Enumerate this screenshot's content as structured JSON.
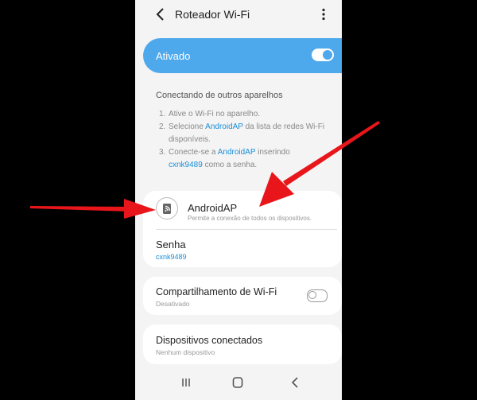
{
  "header": {
    "title": "Roteador Wi-Fi"
  },
  "master": {
    "label": "Ativado",
    "on": true
  },
  "help": {
    "title": "Conectando de outros aparelhos",
    "steps": [
      {
        "num": "1.",
        "text": "Ative o Wi-Fi no aparelho."
      },
      {
        "num": "2.",
        "pre": "Selecione ",
        "link": "AndroidAP",
        "post": " da lista de redes Wi-Fi disponíveis."
      },
      {
        "num": "3.",
        "pre": "Conecte-se a ",
        "link": "AndroidAP",
        "mid": " inserindo ",
        "link2": "cxnk9489",
        "post": " como a senha."
      }
    ]
  },
  "ap": {
    "name": "AndroidAP",
    "description": "Permite a conexão de todos os dispositivos.",
    "password_label": "Senha",
    "password_value": "cxnk9489"
  },
  "share": {
    "label": "Compartilhamento de Wi-Fi",
    "state": "Desativado",
    "on": false
  },
  "devices": {
    "label": "Dispositivos conectados",
    "state": "Nenhum dispositivo"
  },
  "colors": {
    "accent": "#4da8ec",
    "link": "#1a8ed7",
    "annotation_arrow": "#e8161b"
  },
  "icons": {
    "back": "back-arrow-icon",
    "more": "more-vert-icon",
    "ap": "hotspot-icon",
    "recent": "recent-apps-icon",
    "home": "home-icon",
    "nav_back": "nav-back-icon"
  }
}
